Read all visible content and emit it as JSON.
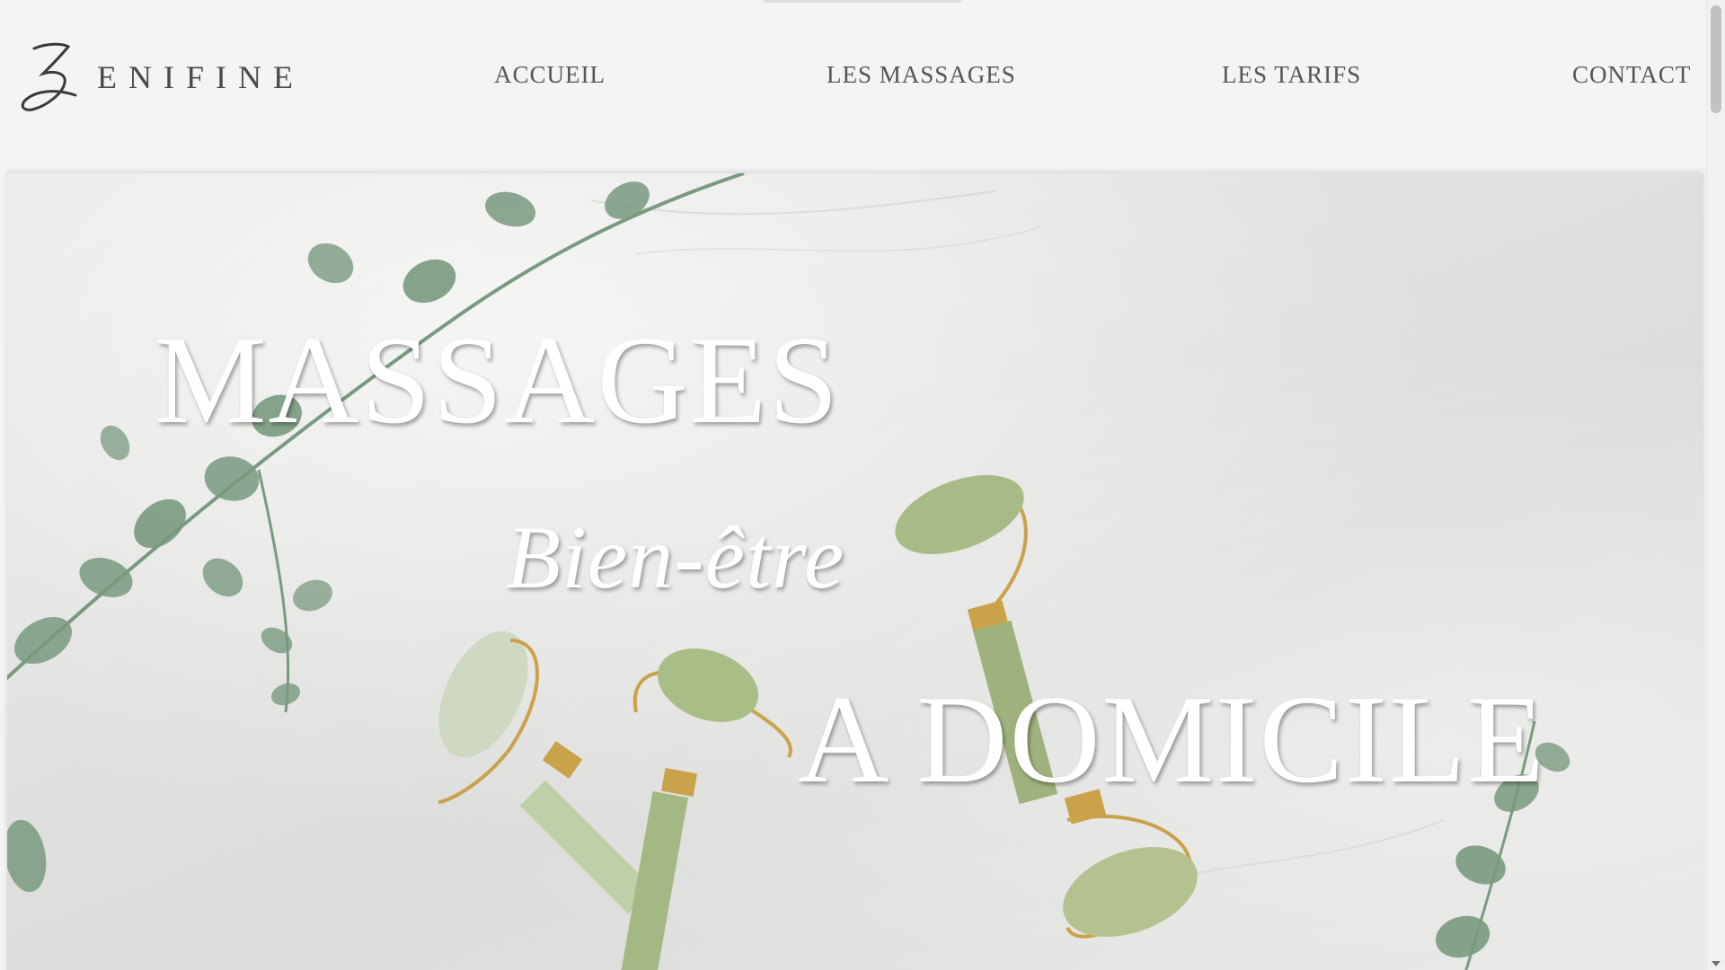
{
  "brand": {
    "logo_letter": "Z",
    "name": "ENIFINE"
  },
  "nav": {
    "items": [
      {
        "label": "ACCUEIL"
      },
      {
        "label": "LES MASSAGES"
      },
      {
        "label": "LES TARIFS"
      },
      {
        "label": "CONTACT"
      }
    ]
  },
  "hero": {
    "line1": "MASSAGES",
    "line2": "Bien-être",
    "line3": "A DOMICILE"
  },
  "colors": {
    "background": "#f4f4f4",
    "nav_text": "#555555",
    "hero_text": "#ffffff",
    "leaf": "#6f8f74",
    "jade": "#a8bb86",
    "gold": "#c9a24a"
  },
  "icons": {
    "scroll_down": "chevron-down-icon"
  }
}
